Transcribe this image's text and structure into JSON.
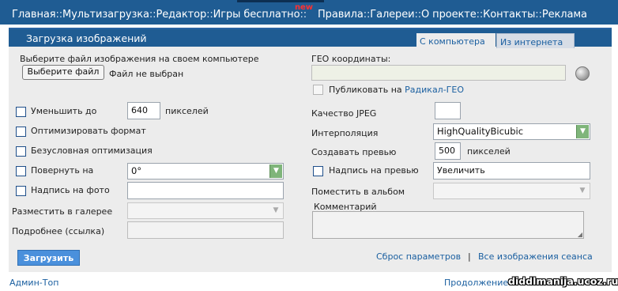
{
  "nav": {
    "items": [
      "Главная",
      "Мультизагрузка",
      "Редактор",
      "Игры бесплатно",
      "Правила",
      "Галереи",
      "О проекте",
      "Контакты",
      "Реклама"
    ],
    "separator": "::",
    "new_badge": "new"
  },
  "header": {
    "title": "Загрузка изображений",
    "tabs": [
      "С компьютера",
      "Из интернета"
    ]
  },
  "form": {
    "file_prompt": "Выберите файл изображения на своем компьютере",
    "file_button": "Выберите файл",
    "file_status": "Файл не выбран",
    "geo_label": "ГЕО координаты:",
    "geo_value": "",
    "publish_label": "Публиковать на",
    "publish_link": "Радикал-ГЕО",
    "reduce_label": "Уменьшить до",
    "reduce_value": "640",
    "reduce_unit": "пикселей",
    "optimize_label": "Оптимизировать формат",
    "force_opt_label": "Безусловная оптимизация",
    "rotate_label": "Повернуть на",
    "rotate_value": "0°",
    "caption_label": "Надпись на фото",
    "caption_value": "",
    "gallery_label": "Разместить в галерее",
    "gallery_value": "",
    "more_label": "Подробнее (ссылка)",
    "more_value": "",
    "jpeg_label": "Качество JPEG",
    "jpeg_value": "",
    "interp_label": "Интерполяция",
    "interp_value": "HighQualityBicubic",
    "preview_label": "Создавать превью",
    "preview_value": "500",
    "preview_unit": "пикселей",
    "preview_caption_label": "Надпись на превью",
    "preview_caption_value": "Увеличить",
    "album_label": "Поместить в альбом",
    "album_value": "",
    "comment_label": "Комментарий",
    "comment_value": "",
    "submit_label": "Загрузить",
    "reset_link": "Сброс параметров",
    "links_separator": "|",
    "session_link": "Все изображения сеанса"
  },
  "footer": {
    "left_link": "Админ-Топ",
    "right_link": "Продолжение",
    "watermark": "diddlmanija.ucoz.ru"
  },
  "colors": {
    "nav_bg": "#1f5c93",
    "panel_bg": "#ececec",
    "accent": "#4a90dc",
    "link": "#1a5fa0",
    "select_arrow": "#7fb57a"
  },
  "icons": [
    "checkbox",
    "globe-icon",
    "dropdown-arrow-icon",
    "resize-grip-icon"
  ]
}
